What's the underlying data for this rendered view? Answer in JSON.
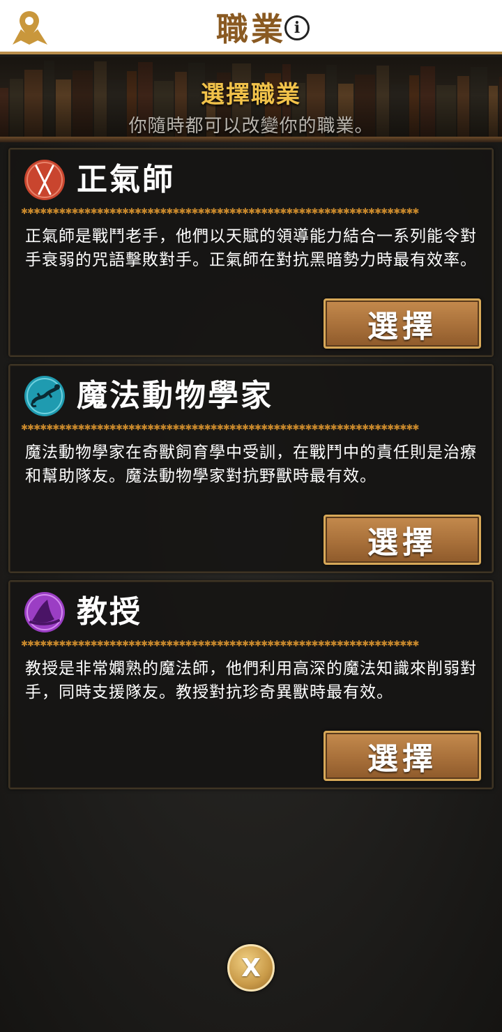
{
  "header": {
    "title": "職業",
    "map_icon": "map-location-icon",
    "info_icon_glyph": "i"
  },
  "banner": {
    "title": "選擇職業",
    "subtitle": "你隨時都可以改變你的職業。"
  },
  "professions": [
    {
      "name": "正氣師",
      "icon": "crossed-wands-icon",
      "icon_color": "#c9452e",
      "description": "正氣師是戰鬥老手，他們以天賦的領導能力結合一系列能令對手衰弱的咒語擊敗對手。正氣師在對抗黑暗勢力時最有效率。",
      "button_label": "選擇"
    },
    {
      "name": "魔法動物學家",
      "icon": "salamander-icon",
      "icon_color": "#1f9bb0",
      "description": "魔法動物學家在奇獸飼育學中受訓，在戰鬥中的責任則是治療和幫助隊友。魔法動物學家對抗野獸時最有效。",
      "button_label": "選擇"
    },
    {
      "name": "教授",
      "icon": "wizard-hat-icon",
      "icon_color": "#9b3ec4",
      "description": "教授是非常嫻熟的魔法師，他們利用高深的魔法知識來削弱對手，同時支援隊友。教授對抗珍奇異獸時最有效。",
      "button_label": "選擇"
    }
  ],
  "close_button_label": "X",
  "colors": {
    "accent_gold": "#f1c24a",
    "header_title": "#8a5a22",
    "divider": "#c9892c",
    "button": "#a8703a"
  }
}
